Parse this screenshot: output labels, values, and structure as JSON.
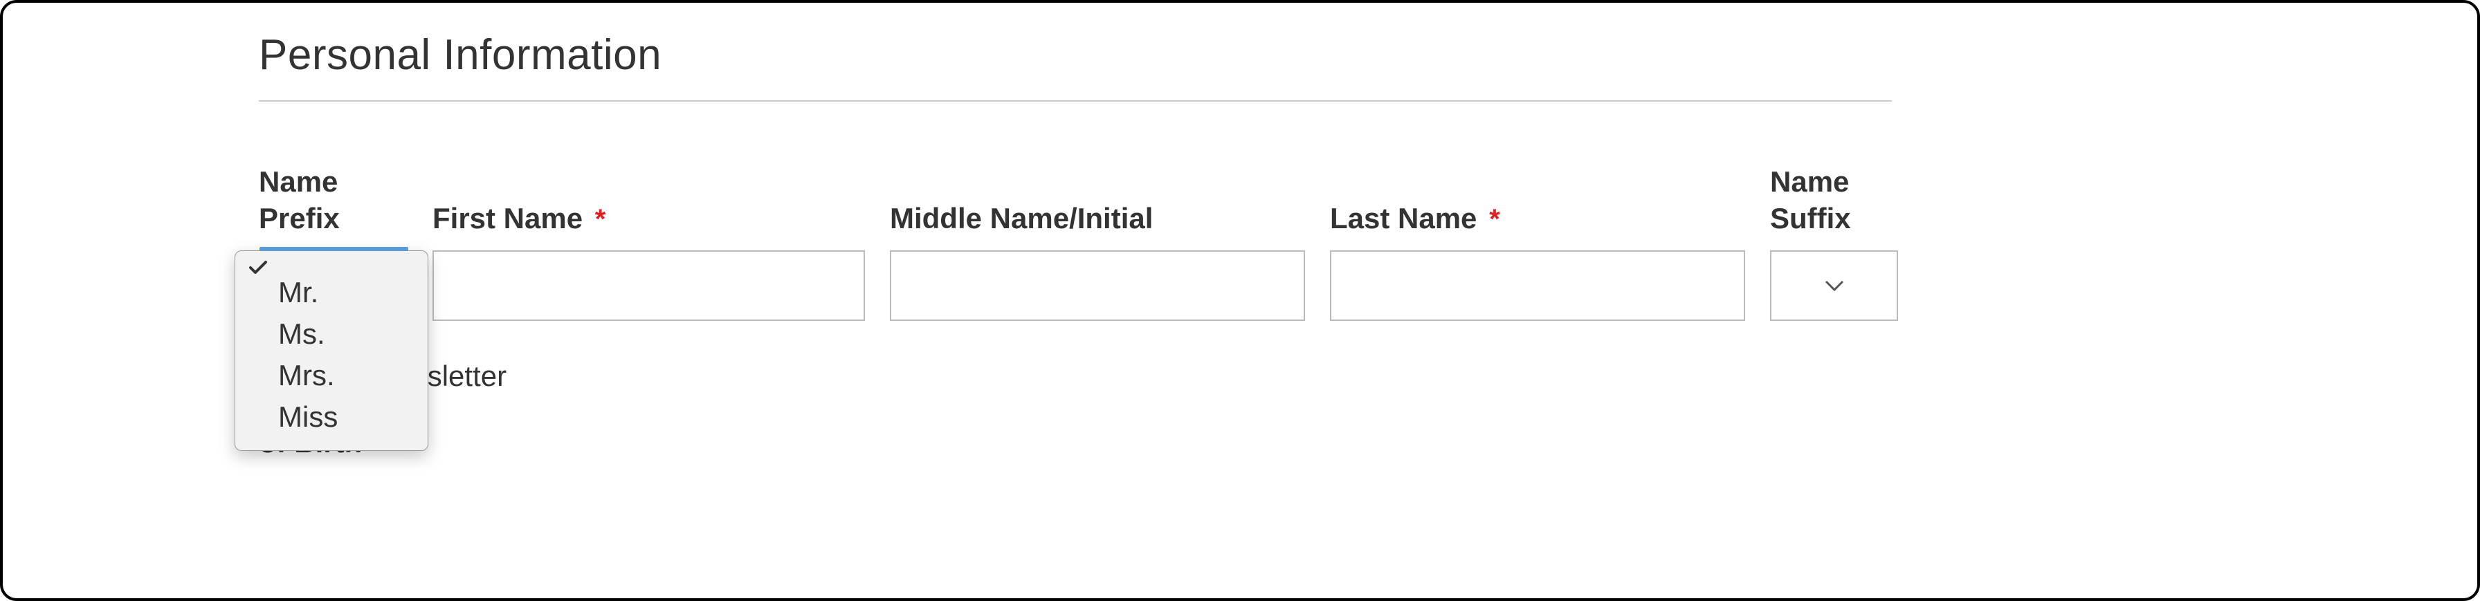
{
  "section": {
    "title": "Personal Information"
  },
  "labels": {
    "name_prefix_line1": "Name",
    "name_prefix_line2": "Prefix",
    "first_name": "First Name",
    "middle_name": "Middle Name/Initial",
    "last_name": "Last Name",
    "name_suffix_line1": "Name",
    "name_suffix_line2": "Suffix",
    "newsletter_partial": "p for Newsletter",
    "date_of_birth_partial": "of Birth"
  },
  "required": {
    "first_name": "*",
    "last_name": "*"
  },
  "values": {
    "first_name": "",
    "middle_name": "",
    "last_name": ""
  },
  "prefix_dropdown": {
    "selected": "",
    "options": [
      "",
      "Mr.",
      "Ms.",
      "Mrs.",
      "Miss"
    ]
  },
  "suffix_dropdown": {
    "selected": ""
  }
}
